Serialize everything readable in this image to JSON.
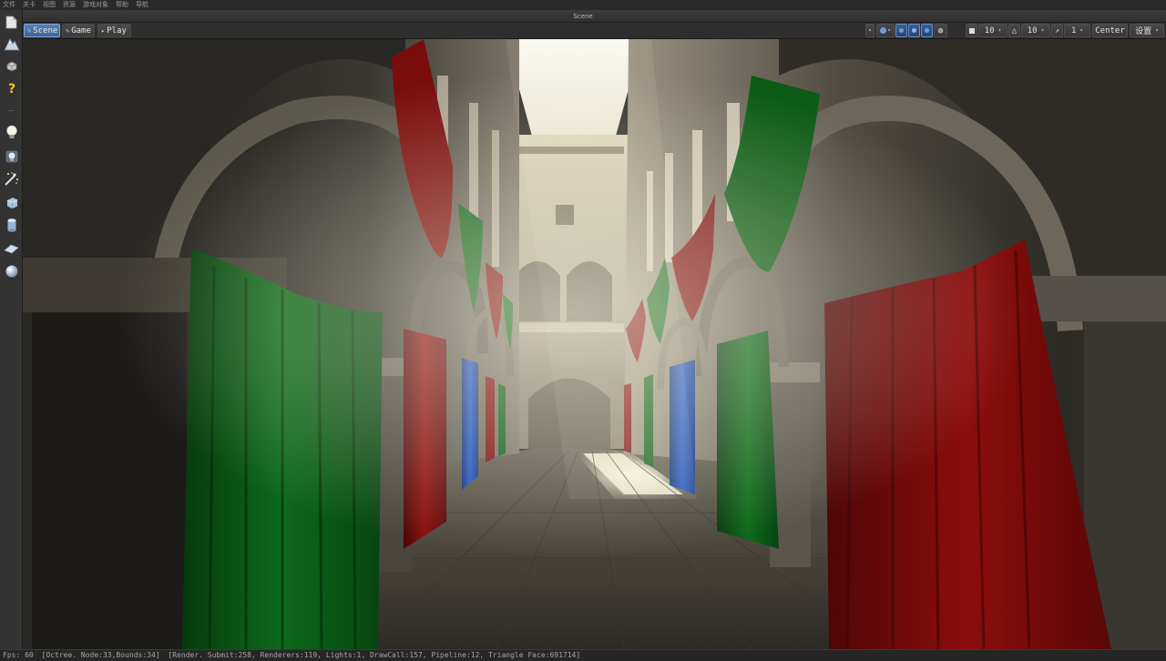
{
  "menu": {
    "items": [
      "文件",
      "关卡",
      "视图",
      "资源",
      "游戏对象",
      "帮助",
      "导航"
    ]
  },
  "window": {
    "title": "Scene"
  },
  "toolbar": {
    "tabs": [
      {
        "label": "Scene",
        "icon": "scene-icon",
        "active": true
      },
      {
        "label": "Game",
        "icon": "game-icon",
        "active": false
      },
      {
        "label": "Play",
        "icon": "play-icon",
        "active": false
      }
    ],
    "grid_value": "10",
    "angle_value": "10",
    "scale_value": "1",
    "pivot_label": "Center",
    "settings_label": "设置",
    "accent_color": "#4a70a8"
  },
  "toolbox": {
    "tools": [
      {
        "name": "new-file-icon"
      },
      {
        "name": "terrain-icon"
      },
      {
        "name": "package-icon"
      },
      {
        "name": "help-icon"
      },
      {
        "name": "point-light-icon"
      },
      {
        "name": "spot-light-icon"
      },
      {
        "name": "particle-icon"
      },
      {
        "name": "cube-icon"
      },
      {
        "name": "cylinder-icon"
      },
      {
        "name": "plane-icon"
      },
      {
        "name": "sphere-icon"
      }
    ]
  },
  "status": {
    "fps": "Fps: 60",
    "octree": "[Octree. Node:33,Bounds:34]",
    "render": "[Render. Submit:258, Renderers:119, Lights:1, DrawCall:157, Pipeline:12, Triangle Face:691714]"
  }
}
